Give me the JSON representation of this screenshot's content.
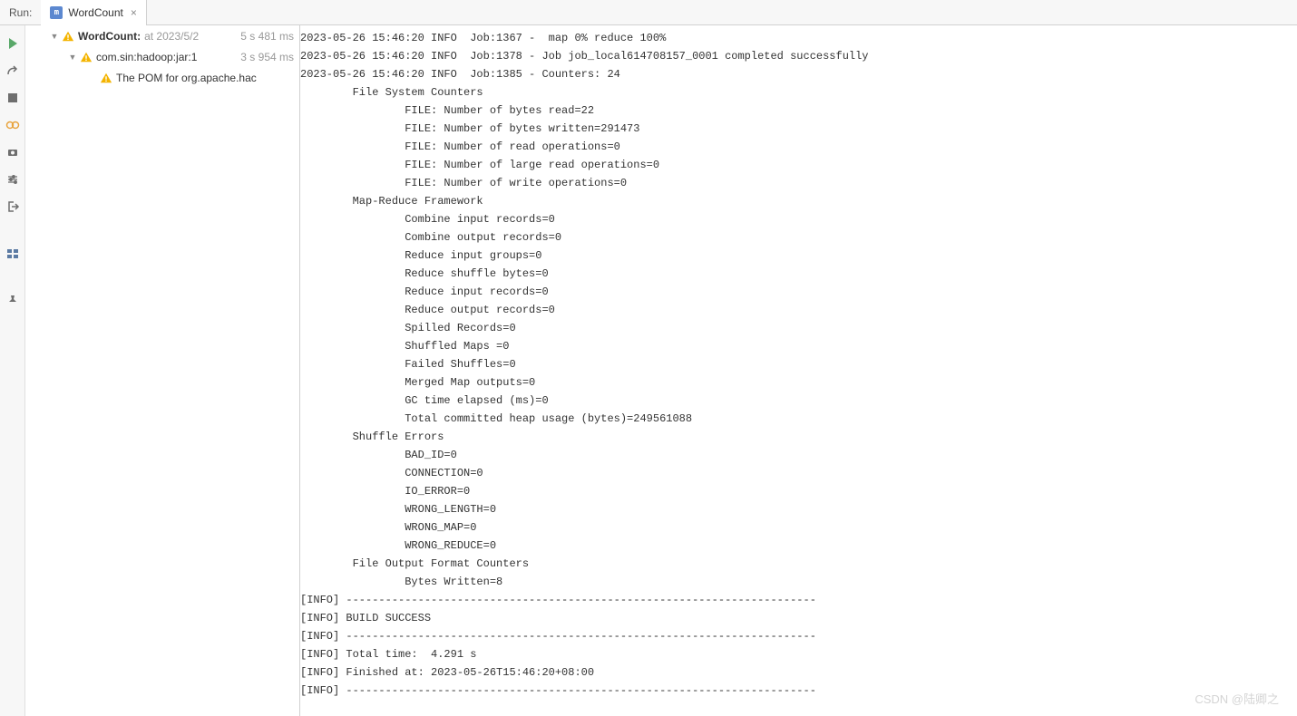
{
  "top": {
    "run_label": "Run:",
    "tab_icon_text": "m",
    "tab_label": "WordCount",
    "tab_close": "×"
  },
  "tree": {
    "rows": [
      {
        "toggle": "▼",
        "label": "WordCount:",
        "bold": true,
        "gray": "at 2023/5/2",
        "time": "5 s 481 ms"
      },
      {
        "toggle": "▼",
        "label": "com.sin:hadoop:jar:1",
        "bold": false,
        "gray": "",
        "time": "3 s 954 ms"
      },
      {
        "toggle": "",
        "label": "The POM for org.apache.hac",
        "bold": false,
        "gray": "",
        "time": ""
      }
    ]
  },
  "console_lines": [
    "2023-05-26 15:46:20 INFO  Job:1367 -  map 0% reduce 100%",
    "2023-05-26 15:46:20 INFO  Job:1378 - Job job_local614708157_0001 completed successfully",
    "2023-05-26 15:46:20 INFO  Job:1385 - Counters: 24",
    "        File System Counters",
    "                FILE: Number of bytes read=22",
    "                FILE: Number of bytes written=291473",
    "                FILE: Number of read operations=0",
    "                FILE: Number of large read operations=0",
    "                FILE: Number of write operations=0",
    "        Map-Reduce Framework",
    "                Combine input records=0",
    "                Combine output records=0",
    "                Reduce input groups=0",
    "                Reduce shuffle bytes=0",
    "                Reduce input records=0",
    "                Reduce output records=0",
    "                Spilled Records=0",
    "                Shuffled Maps =0",
    "                Failed Shuffles=0",
    "                Merged Map outputs=0",
    "                GC time elapsed (ms)=0",
    "                Total committed heap usage (bytes)=249561088",
    "        Shuffle Errors",
    "                BAD_ID=0",
    "                CONNECTION=0",
    "                IO_ERROR=0",
    "                WRONG_LENGTH=0",
    "                WRONG_MAP=0",
    "                WRONG_REDUCE=0",
    "        File Output Format Counters",
    "                Bytes Written=8",
    "[INFO] ------------------------------------------------------------------------",
    "[INFO] BUILD SUCCESS",
    "[INFO] ------------------------------------------------------------------------",
    "[INFO] Total time:  4.291 s",
    "[INFO] Finished at: 2023-05-26T15:46:20+08:00",
    "[INFO] ------------------------------------------------------------------------"
  ],
  "watermark": "CSDN @陆卿之"
}
